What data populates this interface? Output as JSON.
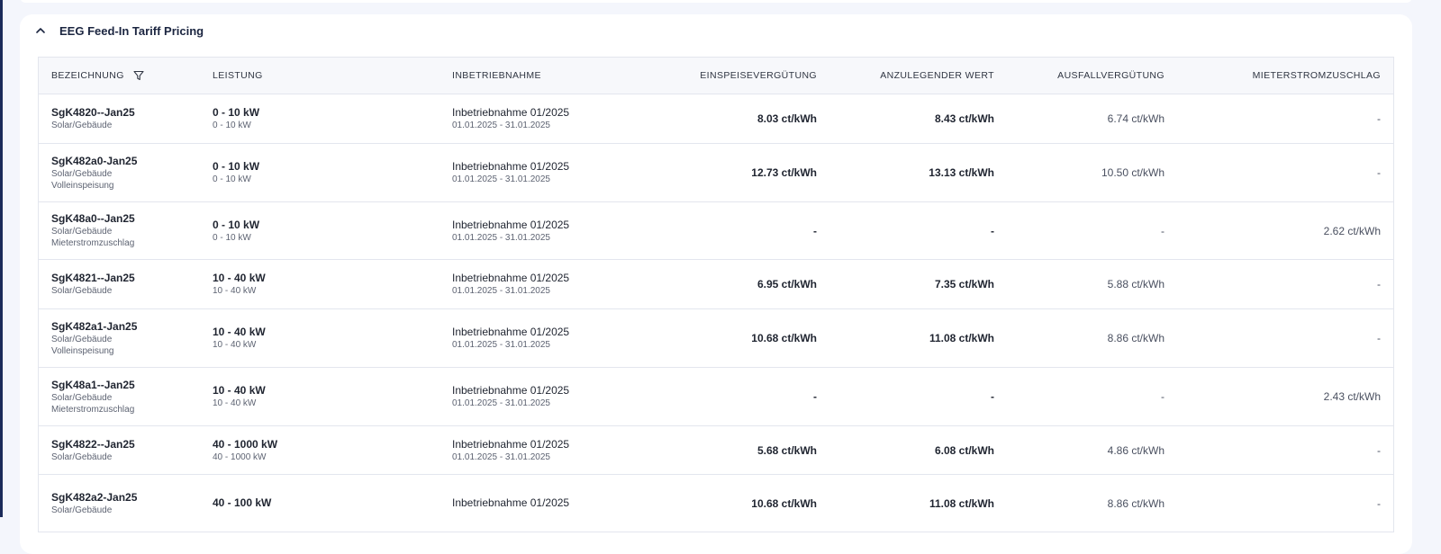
{
  "section": {
    "title": "EEG Feed-In Tariff Pricing"
  },
  "table": {
    "headers": {
      "bezeichnung": "BEZEICHNUNG",
      "leistung": "LEISTUNG",
      "inbetriebnahme": "INBETRIEBNAHME",
      "einspeiseverguetung": "EINSPEISEVERGÜTUNG",
      "anzulegender_wert": "ANZULEGENDER WERT",
      "ausfallverguetung": "AUSFALLVERGÜTUNG",
      "mieterstromzuschlag": "MIETERSTROMZUSCHLAG"
    },
    "rows": [
      {
        "code": "SgK4820--Jan25",
        "sub1": "Solar/Gebäude",
        "sub2": "",
        "power": "0 - 10 kW",
        "power_sub": "0 - 10 kW",
        "commission": "Inbetriebnahme 01/2025",
        "period": "01.01.2025 - 31.01.2025",
        "einspeise": "8.03 ct/kWh",
        "anzulegender": "8.43 ct/kWh",
        "ausfall": "6.74 ct/kWh",
        "mieterstrom": "-"
      },
      {
        "code": "SgK482a0-Jan25",
        "sub1": "Solar/Gebäude",
        "sub2": "Volleinspeisung",
        "power": "0 - 10 kW",
        "power_sub": "0 - 10 kW",
        "commission": "Inbetriebnahme 01/2025",
        "period": "01.01.2025 - 31.01.2025",
        "einspeise": "12.73 ct/kWh",
        "anzulegender": "13.13 ct/kWh",
        "ausfall": "10.50 ct/kWh",
        "mieterstrom": "-"
      },
      {
        "code": "SgK48a0--Jan25",
        "sub1": "Solar/Gebäude",
        "sub2": "Mieterstromzuschlag",
        "power": "0 - 10 kW",
        "power_sub": "0 - 10 kW",
        "commission": "Inbetriebnahme 01/2025",
        "period": "01.01.2025 - 31.01.2025",
        "einspeise": "-",
        "anzulegender": "-",
        "ausfall": "-",
        "mieterstrom": "2.62 ct/kWh"
      },
      {
        "code": "SgK4821--Jan25",
        "sub1": "Solar/Gebäude",
        "sub2": "",
        "power": "10 - 40 kW",
        "power_sub": "10 - 40 kW",
        "commission": "Inbetriebnahme 01/2025",
        "period": "01.01.2025 - 31.01.2025",
        "einspeise": "6.95 ct/kWh",
        "anzulegender": "7.35 ct/kWh",
        "ausfall": "5.88 ct/kWh",
        "mieterstrom": "-"
      },
      {
        "code": "SgK482a1-Jan25",
        "sub1": "Solar/Gebäude",
        "sub2": "Volleinspeisung",
        "power": "10 - 40 kW",
        "power_sub": "10 - 40 kW",
        "commission": "Inbetriebnahme 01/2025",
        "period": "01.01.2025 - 31.01.2025",
        "einspeise": "10.68 ct/kWh",
        "anzulegender": "11.08 ct/kWh",
        "ausfall": "8.86 ct/kWh",
        "mieterstrom": "-"
      },
      {
        "code": "SgK48a1--Jan25",
        "sub1": "Solar/Gebäude",
        "sub2": "Mieterstromzuschlag",
        "power": "10 - 40 kW",
        "power_sub": "10 - 40 kW",
        "commission": "Inbetriebnahme 01/2025",
        "period": "01.01.2025 - 31.01.2025",
        "einspeise": "-",
        "anzulegender": "-",
        "ausfall": "-",
        "mieterstrom": "2.43 ct/kWh"
      },
      {
        "code": "SgK4822--Jan25",
        "sub1": "Solar/Gebäude",
        "sub2": "",
        "power": "40 - 1000 kW",
        "power_sub": "40 - 1000 kW",
        "commission": "Inbetriebnahme 01/2025",
        "period": "01.01.2025 - 31.01.2025",
        "einspeise": "5.68 ct/kWh",
        "anzulegender": "6.08 ct/kWh",
        "ausfall": "4.86 ct/kWh",
        "mieterstrom": "-"
      },
      {
        "code": "SgK482a2-Jan25",
        "sub1": "Solar/Gebäude",
        "sub2": "",
        "power": "40 - 100 kW",
        "power_sub": "",
        "commission": "Inbetriebnahme 01/2025",
        "period": "",
        "einspeise": "10.68 ct/kWh",
        "anzulegender": "11.08 ct/kWh",
        "ausfall": "8.86 ct/kWh",
        "mieterstrom": "-"
      }
    ]
  }
}
